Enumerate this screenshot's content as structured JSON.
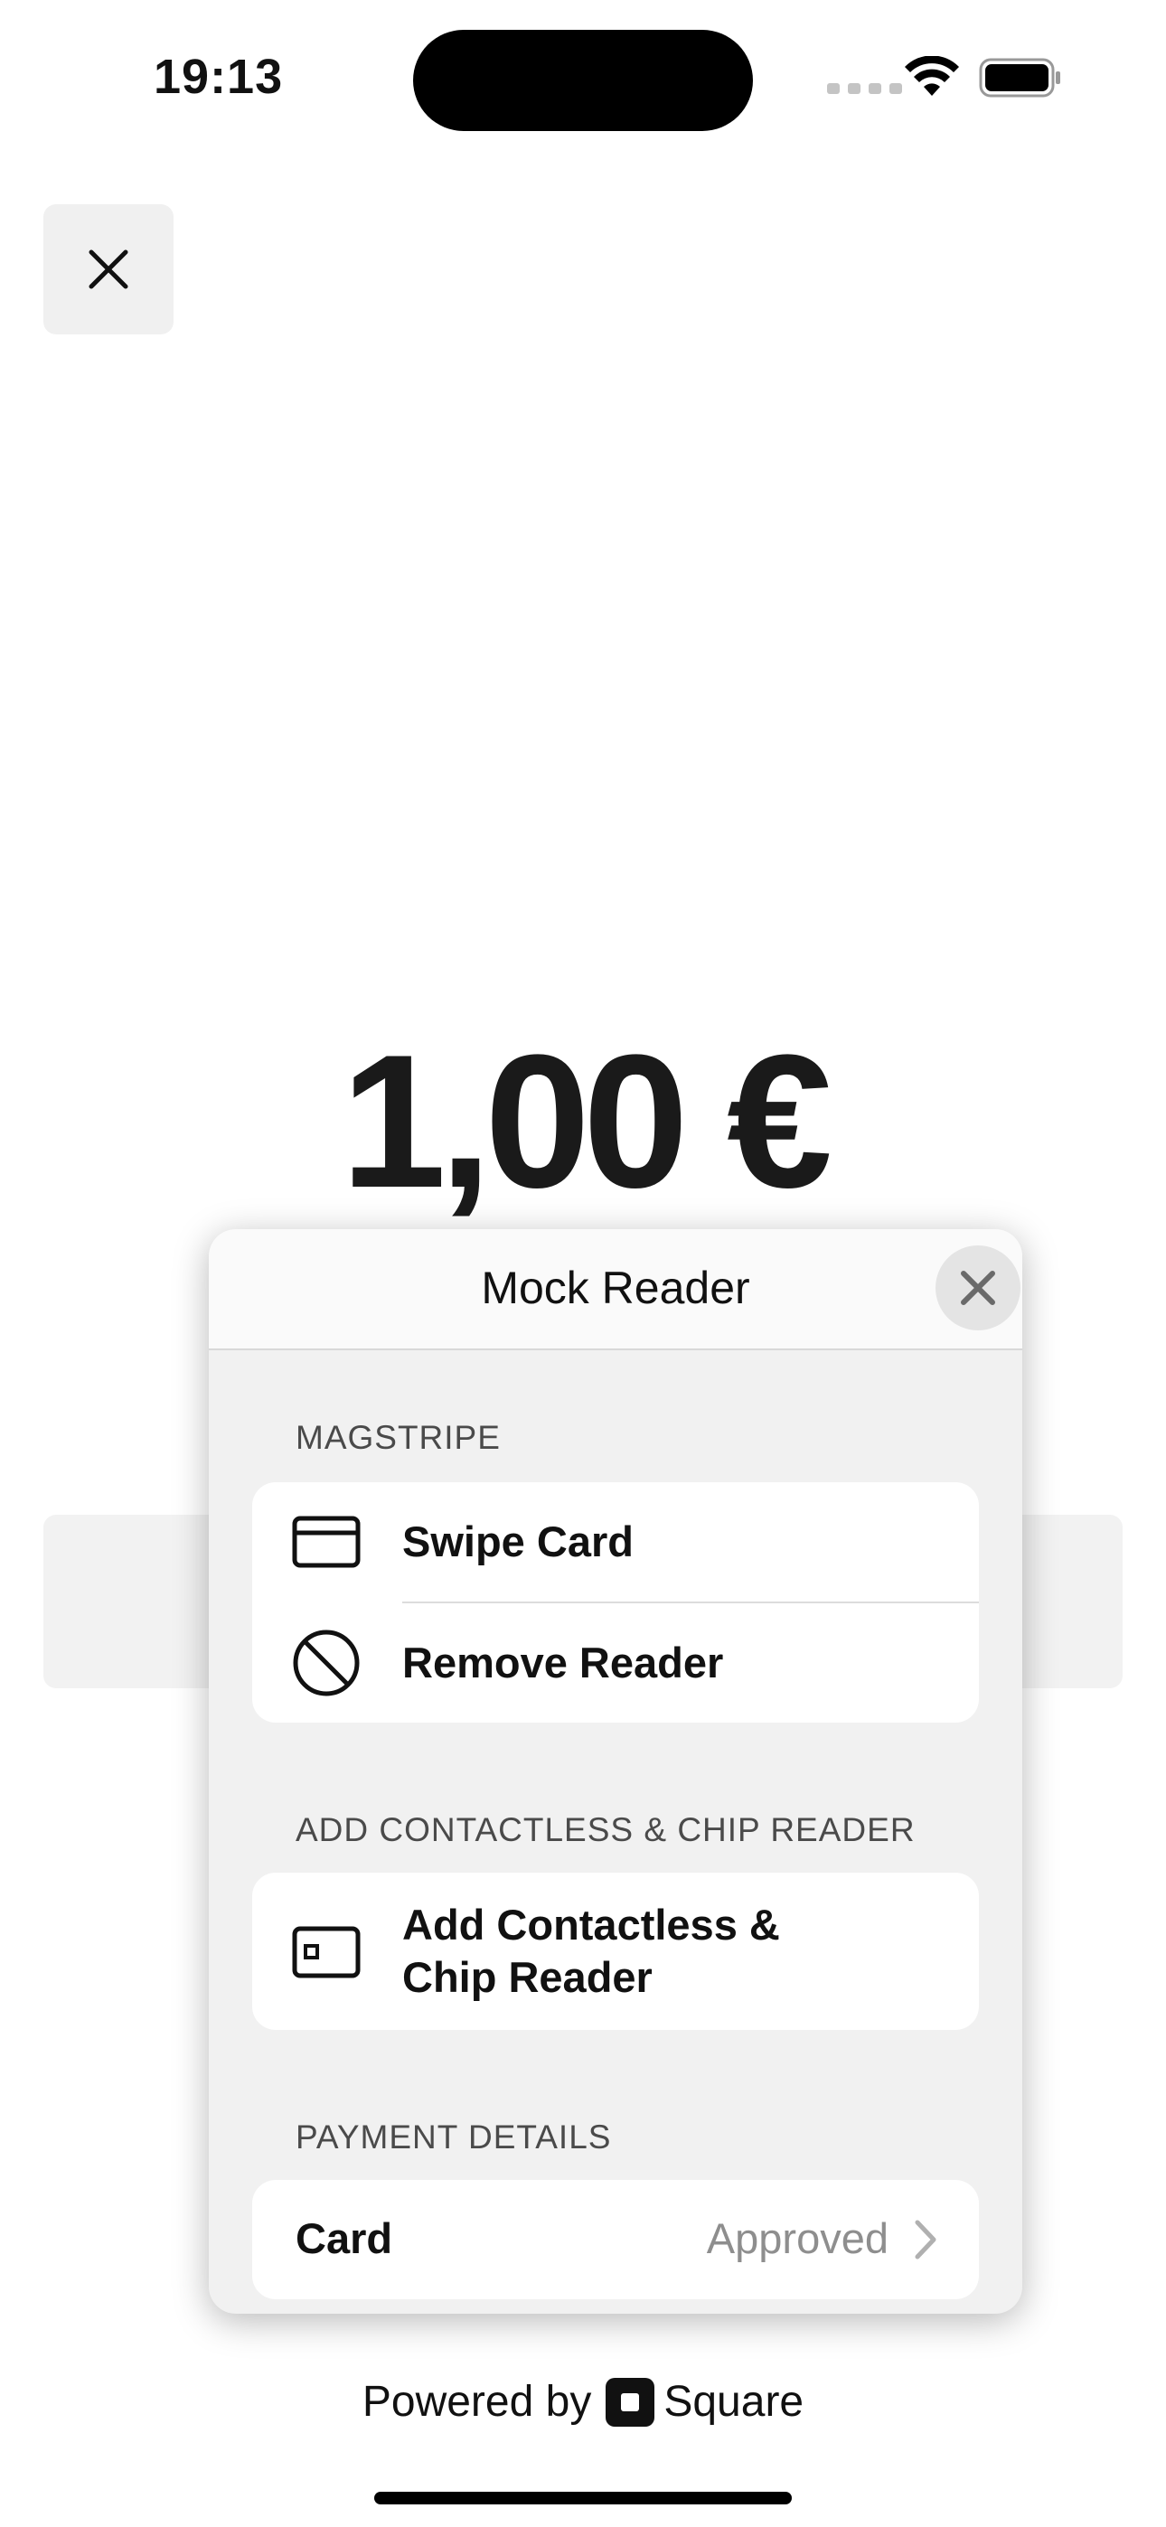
{
  "status_bar": {
    "time": "19:13"
  },
  "payment": {
    "amount": "1,00 €"
  },
  "modal": {
    "title": "Mock Reader",
    "sections": [
      {
        "label": "MAGSTRIPE",
        "items": [
          "Swipe Card",
          "Remove Reader"
        ]
      },
      {
        "label": "ADD CONTACTLESS & CHIP READER",
        "items": [
          "Add Contactless &\nChip Reader"
        ]
      },
      {
        "label": "PAYMENT DETAILS",
        "items": []
      }
    ],
    "payment_details": {
      "card_label": "Card",
      "card_value": "Approved"
    }
  },
  "footer": {
    "powered_by": "Powered by",
    "brand": "Square"
  },
  "icons": [
    "close-icon",
    "card-icon",
    "block-icon",
    "chip-reader-icon",
    "chevron-right-icon",
    "wifi-icon",
    "battery-icon",
    "square-logo-icon"
  ]
}
